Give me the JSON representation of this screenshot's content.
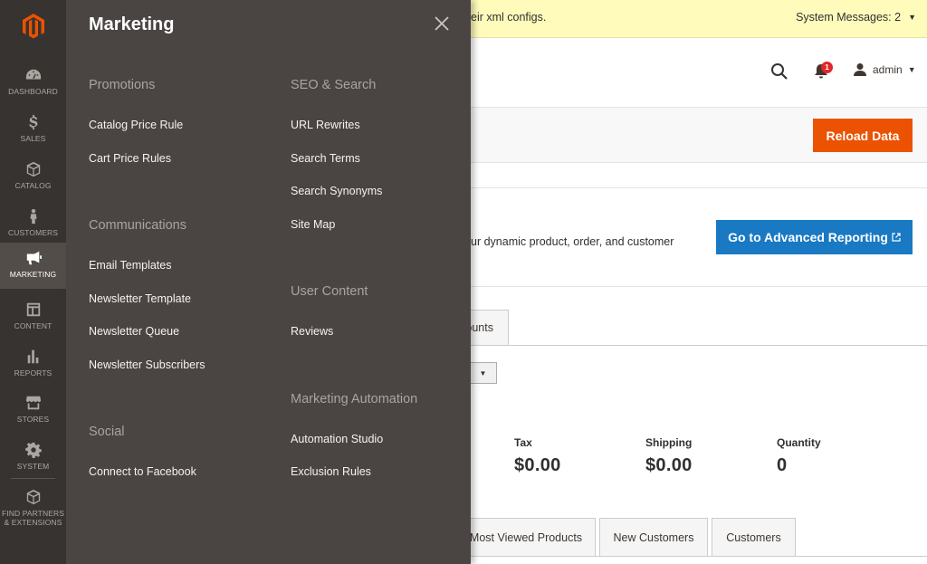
{
  "nav": {
    "items": [
      {
        "label": "DASHBOARD",
        "icon": "dashboard-icon"
      },
      {
        "label": "SALES",
        "icon": "dollar-icon"
      },
      {
        "label": "CATALOG",
        "icon": "box-icon"
      },
      {
        "label": "CUSTOMERS",
        "icon": "person-icon"
      },
      {
        "label": "MARKETING",
        "icon": "megaphone-icon",
        "active": true
      },
      {
        "label": "CONTENT",
        "icon": "layout-icon"
      },
      {
        "label": "REPORTS",
        "icon": "bar-chart-icon"
      },
      {
        "label": "STORES",
        "icon": "store-icon"
      },
      {
        "label": "SYSTEM",
        "icon": "gear-icon"
      },
      {
        "label_line1": "FIND PARTNERS",
        "label_line2": "& EXTENSIONS",
        "icon": "extensions-box-icon"
      }
    ]
  },
  "flyout": {
    "title": "Marketing",
    "groups": {
      "promotions": {
        "title": "Promotions",
        "links": [
          "Catalog Price Rule",
          "Cart Price Rules"
        ]
      },
      "communications": {
        "title": "Communications",
        "links": [
          "Email Templates",
          "Newsletter Template",
          "Newsletter Queue",
          "Newsletter Subscribers"
        ]
      },
      "social": {
        "title": "Social",
        "links": [
          "Connect to Facebook"
        ]
      },
      "seo": {
        "title": "SEO & Search",
        "links": [
          "URL Rewrites",
          "Search Terms",
          "Search Synonyms",
          "Site Map"
        ]
      },
      "user_content": {
        "title": "User Content",
        "links": [
          "Reviews"
        ]
      },
      "automation": {
        "title": "Marketing Automation",
        "links": [
          "Automation Studio",
          "Exclusion Rules"
        ]
      }
    }
  },
  "system_bar": {
    "message_fragment": "eir xml configs.",
    "messages_label": "System Messages: 2"
  },
  "header": {
    "notifications_count": "1",
    "user_name": "admin"
  },
  "reload": {
    "button_label": "Reload Data"
  },
  "advanced": {
    "text_fragment": "ur dynamic product, order, and customer",
    "button_label": "Go to Advanced Reporting"
  },
  "top_tab_fragment": "ounts",
  "stats": [
    {
      "label": "Tax",
      "value": "$0.00"
    },
    {
      "label": "Shipping",
      "value": "$0.00"
    },
    {
      "label": "Quantity",
      "value": "0"
    }
  ],
  "bottom_tabs": [
    "Most Viewed Products",
    "New Customers",
    "Customers"
  ],
  "colors": {
    "nav_bg": "#373330",
    "flyout_bg": "#4a4542",
    "accent_orange": "#eb5202",
    "accent_blue": "#1979c3",
    "notice_yellow": "#fffbbb"
  }
}
